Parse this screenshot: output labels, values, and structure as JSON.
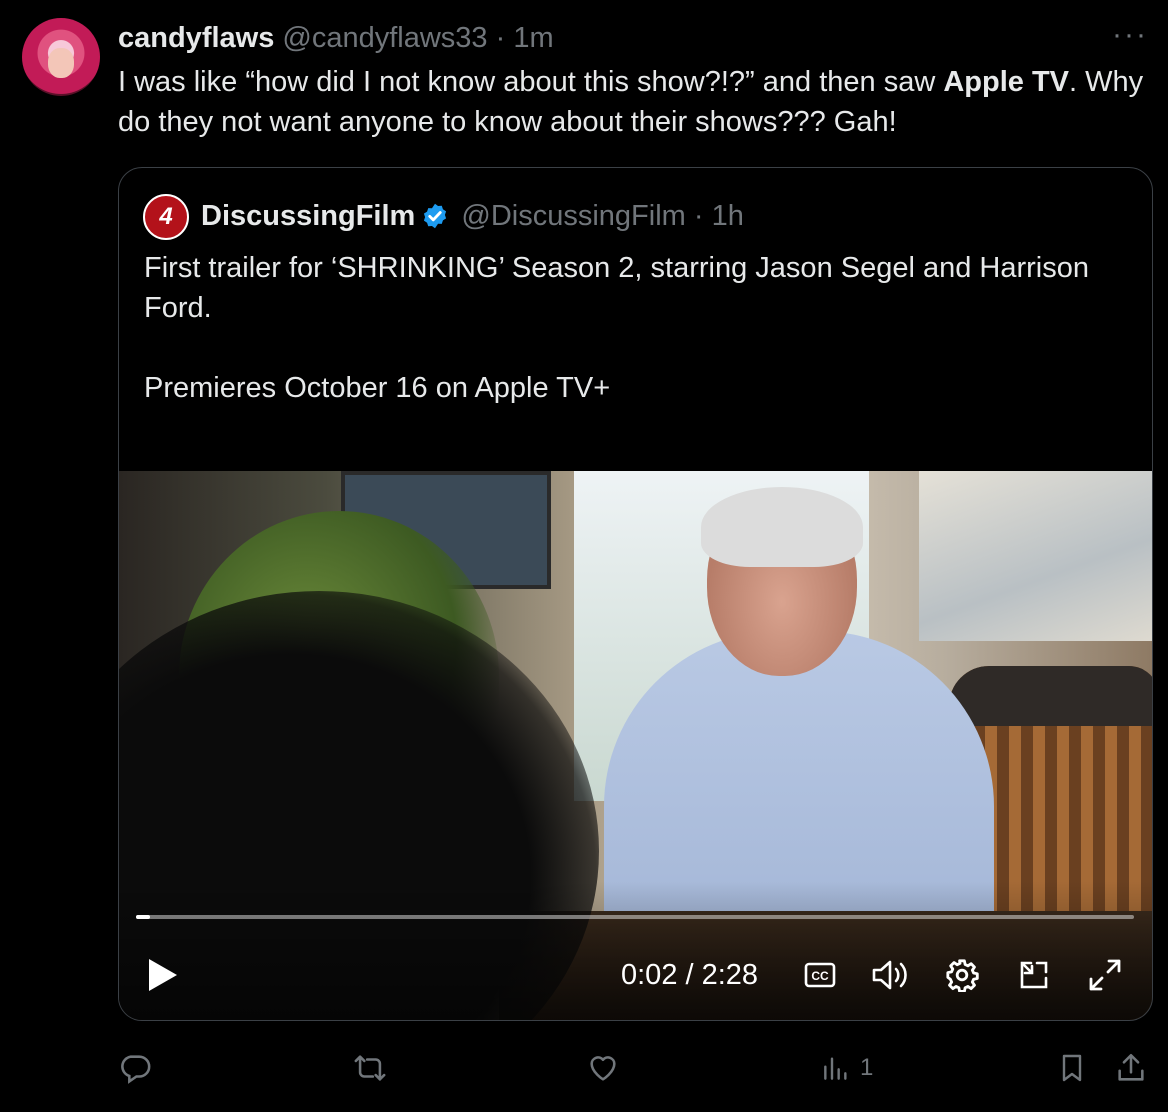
{
  "tweet": {
    "display_name": "candyflaws",
    "handle": "@candyflaws33",
    "separator": "·",
    "time": "1m",
    "more": "···",
    "text_before": "I was like “how did I not know about this show?!?” and then saw ",
    "text_bold": "Apple TV",
    "text_after": ". Why do they not want anyone to know about their shows??? Gah!"
  },
  "quote": {
    "avatar_text": "4",
    "display_name": "DiscussingFilm",
    "handle": "@DiscussingFilm",
    "separator": "·",
    "time": "1h",
    "text": "First trailer for ‘SHRINKING’ Season 2, starring Jason Segel and Harrison Ford.\n\nPremieres October 16 on Apple TV+",
    "video": {
      "current_time": "0:02",
      "duration": "2:28",
      "time_display": "0:02 / 2:28",
      "progress_fraction": 0.014
    }
  },
  "actions": {
    "views_count": "1"
  },
  "colors": {
    "background": "#000000",
    "text": "#e7e9ea",
    "muted": "#71767b",
    "verified": "#1d9bf0",
    "border": "#3b4046"
  },
  "icons": [
    "more-icon",
    "verified-badge-icon",
    "play-icon",
    "captions-icon",
    "volume-icon",
    "settings-gear-icon",
    "picture-in-picture-icon",
    "fullscreen-icon",
    "reply-icon",
    "retweet-icon",
    "like-icon",
    "views-icon",
    "bookmark-icon",
    "share-icon"
  ]
}
